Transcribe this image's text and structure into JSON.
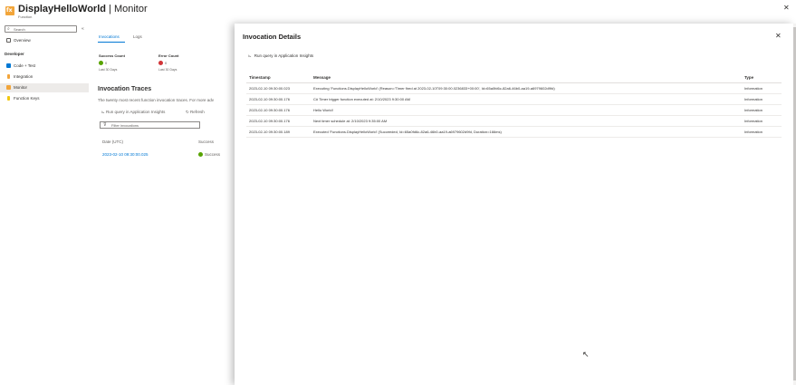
{
  "header": {
    "title": "DisplayHelloWorld",
    "separator": "|",
    "section": "Monitor",
    "subtitle": "Function",
    "more": "···",
    "close": "✕"
  },
  "nav": {
    "search_placeholder": "Search",
    "collapse": "«",
    "overview": "Overview",
    "section_developer": "Developer",
    "items": [
      {
        "label": "Code + Test",
        "icon": "code-icon",
        "color": "#0078d4"
      },
      {
        "label": "Integration",
        "icon": "bolt-icon",
        "color": "#f2a53a"
      },
      {
        "label": "Monitor",
        "icon": "monitor-icon",
        "color": "#f2a53a"
      },
      {
        "label": "Function Keys",
        "icon": "key-icon",
        "color": "#f2c811"
      }
    ]
  },
  "main": {
    "tabs": [
      "Invocations",
      "Logs"
    ],
    "success_count_label": "Success Count",
    "success_count_value": "0",
    "success_count_sub": "Last 30 Days",
    "error_count_label": "Error Count",
    "error_count_value": "0",
    "error_count_sub": "Last 30 Days",
    "traces_title": "Invocation Traces",
    "traces_desc": "The twenty most recent function invocation traces. For more adv",
    "run_query": "Run query in Application Insights",
    "refresh": "Refresh",
    "filter_placeholder": "Filter invocations",
    "col_date": "Date (UTC)",
    "col_success": "Success",
    "trace_date": "2023-02-10 09:30:00.025",
    "trace_status": "Success"
  },
  "blade": {
    "title": "Invocation Details",
    "close": "✕",
    "run_query": "Run query in Application Insights",
    "columns": {
      "timestamp": "Timestamp",
      "message": "Message",
      "type": "Type"
    },
    "rows": [
      {
        "timestamp": "2023-02-10 09:30:00.023",
        "message": "Executing 'Functions.DisplayHelloWorld' (Reason='Timer fired at 2023-02-10T09:30:00.0236833+00:00', Id=65a0fd6c-82a6-46b0-aa19-a6979602d9fd)",
        "type": "Information"
      },
      {
        "timestamp": "2023-02-10 09:30:00.176",
        "message": "C# Timer trigger function executed at: 2/10/2023 9:30:00 AM",
        "type": "Information"
      },
      {
        "timestamp": "2023-02-10 09:30:00.176",
        "message": "Hello World!",
        "type": "Information"
      },
      {
        "timestamp": "2023-02-10 09:30:00.176",
        "message": "Next timer schedule at: 2/10/2023 9:35:00 AM",
        "type": "Information"
      },
      {
        "timestamp": "2023-02-10 09:30:00.189",
        "message": "Executed 'Functions.DisplayHelloWorld' (Succeeded, Id=65a0fd6c-82a6-46b0-aa19-a6979602d9fd, Duration=166ms)",
        "type": "Information"
      }
    ]
  }
}
